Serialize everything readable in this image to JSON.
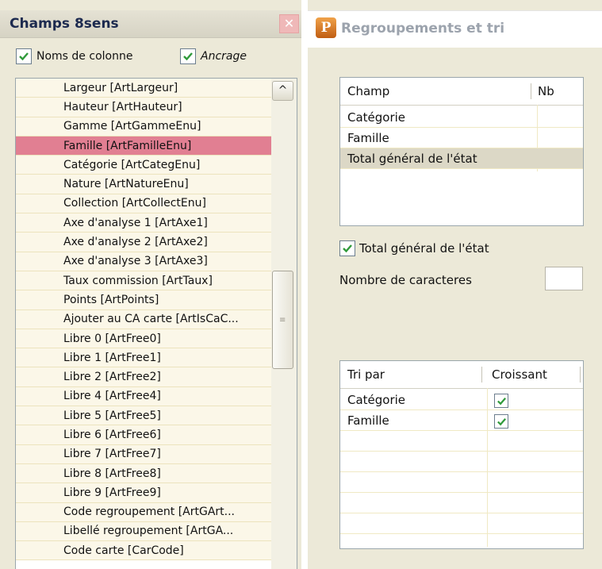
{
  "left_panel": {
    "title": "Champs 8sens",
    "close_glyph": "✕",
    "checkboxes": [
      {
        "label": "Noms de colonne",
        "checked": true
      },
      {
        "label": "Ancrage",
        "checked": true
      }
    ],
    "fields": [
      "Largeur [ArtLargeur]",
      "Hauteur [ArtHauteur]",
      "Gamme [ArtGammeEnu]",
      "Famille [ArtFamilleEnu]",
      "Catégorie [ArtCategEnu]",
      "Nature [ArtNatureEnu]",
      "Collection [ArtCollectEnu]",
      "Axe d'analyse 1 [ArtAxe1]",
      "Axe d'analyse 2 [ArtAxe2]",
      "Axe d'analyse 3 [ArtAxe3]",
      "Taux commission [ArtTaux]",
      "Points [ArtPoints]",
      "Ajouter au CA carte [ArtIsCaC...",
      "Libre 0 [ArtFree0]",
      "Libre 1 [ArtFree1]",
      "Libre 2 [ArtFree2]",
      "Libre 4 [ArtFree4]",
      "Libre 5 [ArtFree5]",
      "Libre 6 [ArtFree6]",
      "Libre 7 [ArtFree7]",
      "Libre 8 [ArtFree8]",
      "Libre 9 [ArtFree9]",
      "Code regroupement [ArtGArt...",
      "Libellé regroupement [ArtGA...",
      "Code carte [CarCode]"
    ],
    "selected_index": 3,
    "scroll_up_glyph": "^",
    "thumb_grip_glyph": "≡",
    "scroll_position": 0.45
  },
  "right_panel": {
    "title": "Regroupements et tri",
    "icon_letter": "P",
    "group_grid": {
      "headers": {
        "champ": "Champ",
        "nb": "Nb"
      },
      "rows": [
        {
          "champ": "Catégorie",
          "nb": ""
        },
        {
          "champ": "Famille",
          "nb": ""
        },
        {
          "champ": "Total général de l'état",
          "nb": ""
        }
      ],
      "highlighted_index": 2
    },
    "total_checkbox": {
      "label": "Total général de l'état",
      "checked": true
    },
    "nb_caracteres": {
      "label": "Nombre de caracteres",
      "value": ""
    },
    "sort_grid": {
      "headers": {
        "tri_par": "Tri par",
        "croissant": "Croissant"
      },
      "rows": [
        {
          "tri_par": "Catégorie",
          "croissant": true
        },
        {
          "tri_par": "Famille",
          "croissant": true
        }
      ],
      "empty_rows": 6
    }
  },
  "colors": {
    "selected_row": "#e17f92",
    "row_bg": "#fbf7e8",
    "highlight_row": "#dcd8c6",
    "check_green": "#2f9a3a",
    "panel_bg": "#ece9d8"
  }
}
